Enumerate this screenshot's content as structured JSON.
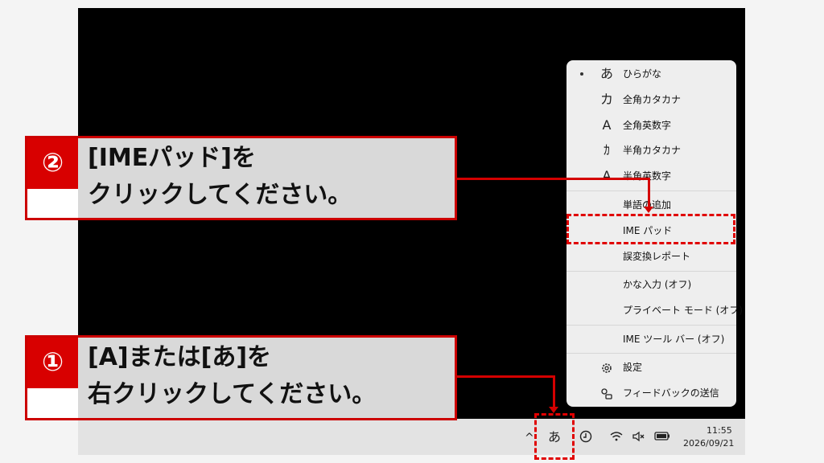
{
  "taskbar": {
    "chevron": "^",
    "ime_indicator": "あ",
    "clock_time": "11:55",
    "clock_date": "2026/09/21"
  },
  "ime_menu": {
    "items": [
      {
        "icon": "あ",
        "label": "ひらがな",
        "selected": true
      },
      {
        "icon": "カ",
        "label": "全角カタカナ"
      },
      {
        "icon": "A",
        "label": "全角英数字"
      },
      {
        "icon": "ｶ",
        "label": "半角カタカナ"
      },
      {
        "icon": "A",
        "label": "半角英数字"
      },
      {
        "label": "単語の追加"
      },
      {
        "label": "IME パッド"
      },
      {
        "label": "誤変換レポート"
      },
      {
        "label": "かな入力 (オフ)"
      },
      {
        "label": "プライベート モード (オフ)"
      },
      {
        "label": "IME ツール バー (オフ)"
      },
      {
        "label": "設定"
      },
      {
        "label": "フィードバックの送信"
      }
    ]
  },
  "callouts": {
    "step2": {
      "number": "②",
      "line1": "[IMEパッド]を",
      "line2": "クリックしてください。"
    },
    "step1": {
      "number": "①",
      "line1": "[A]または[あ]を",
      "line2": "右クリックしてください。"
    }
  },
  "colors": {
    "accent_red": "#d80000",
    "callout_gray": "#d9d9d9"
  }
}
